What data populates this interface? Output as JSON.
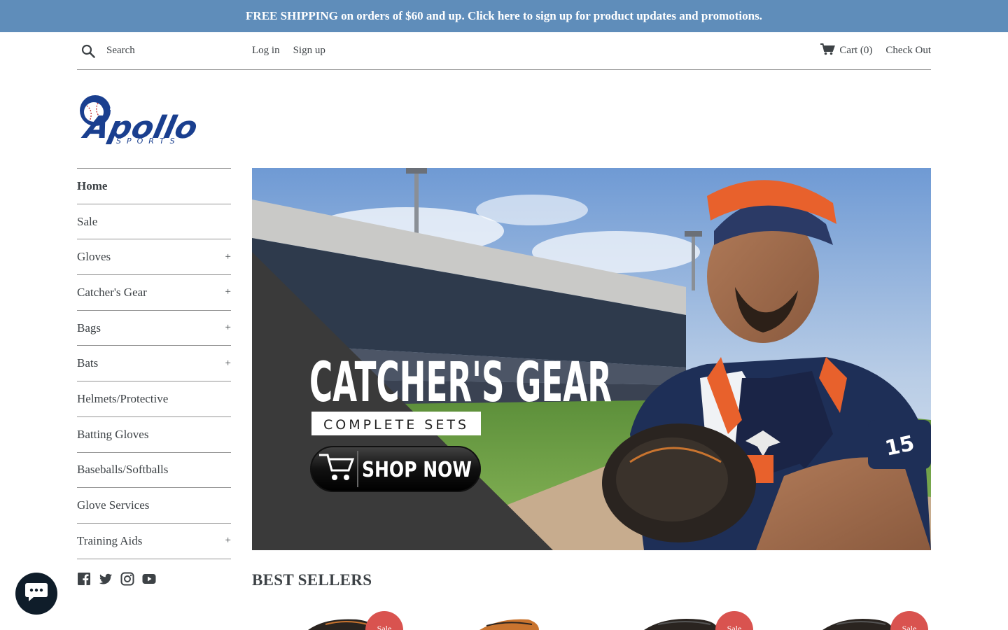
{
  "announcement": {
    "text": "FREE SHIPPING on orders of $60 and up. Click here to sign up for product updates and promotions."
  },
  "header": {
    "search_placeholder": "Search",
    "login_label": "Log in",
    "signup_label": "Sign up",
    "cart_label": "Cart (0)",
    "checkout_label": "Check Out"
  },
  "logo": {
    "wordmark": "Apollo",
    "subtitle": "SPORTS"
  },
  "sidebar": {
    "items": [
      {
        "label": "Home",
        "expandable": false,
        "active": true
      },
      {
        "label": "Sale",
        "expandable": false
      },
      {
        "label": "Gloves",
        "expandable": true
      },
      {
        "label": "Catcher's Gear",
        "expandable": true
      },
      {
        "label": "Bags",
        "expandable": true
      },
      {
        "label": "Bats",
        "expandable": true
      },
      {
        "label": "Helmets/Protective",
        "expandable": false
      },
      {
        "label": "Batting Gloves",
        "expandable": false
      },
      {
        "label": "Baseballs/Softballs",
        "expandable": false
      },
      {
        "label": "Glove Services",
        "expandable": false
      },
      {
        "label": "Training Aids",
        "expandable": true
      }
    ],
    "expand_symbol": "+"
  },
  "social": [
    "facebook-icon",
    "twitter-icon",
    "instagram-icon",
    "youtube-icon"
  ],
  "hero": {
    "headline": "CATCHER'S GEAR",
    "subheadline": "COMPLETE SETS",
    "cta": "SHOP NOW",
    "jersey_number": "15"
  },
  "best_sellers": {
    "heading": "BEST SELLERS",
    "sale_badge": "Sale"
  },
  "colors": {
    "announcement_bg": "#5f8dba",
    "text": "#3d4246",
    "brand_blue": "#1a3f8f",
    "sale_red": "#d9534f",
    "chat_bg": "#0f1d2a"
  }
}
